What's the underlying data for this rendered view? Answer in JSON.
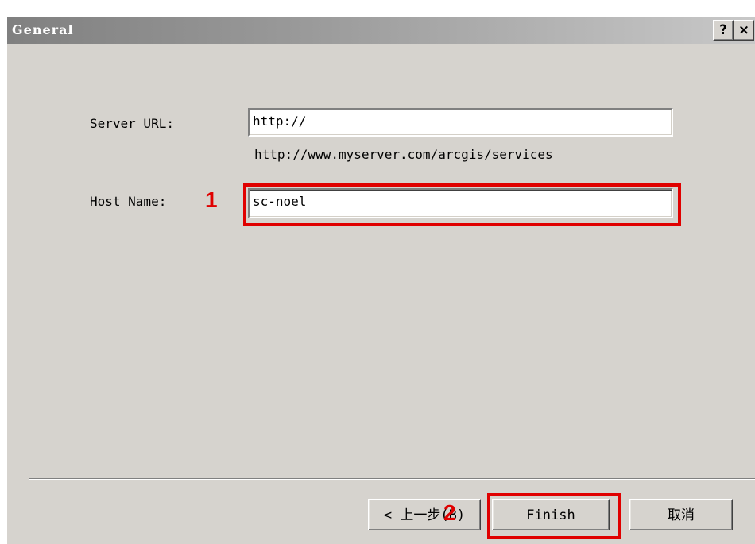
{
  "window": {
    "title": "General",
    "help_label": "?",
    "close_label": "×"
  },
  "form": {
    "server_url_label": "Server URL:",
    "server_url_value": "http://",
    "server_url_hint": "http://www.myserver.com/arcgis/services",
    "host_name_label": "Host Name:",
    "host_name_value": "sc-noel"
  },
  "buttons": {
    "back_label": "< 上一步(B)",
    "finish_label": "Finish",
    "cancel_label": "取消"
  },
  "annotations": {
    "marker_1": "1",
    "marker_2": "2",
    "highlight_color": "#e00000"
  }
}
